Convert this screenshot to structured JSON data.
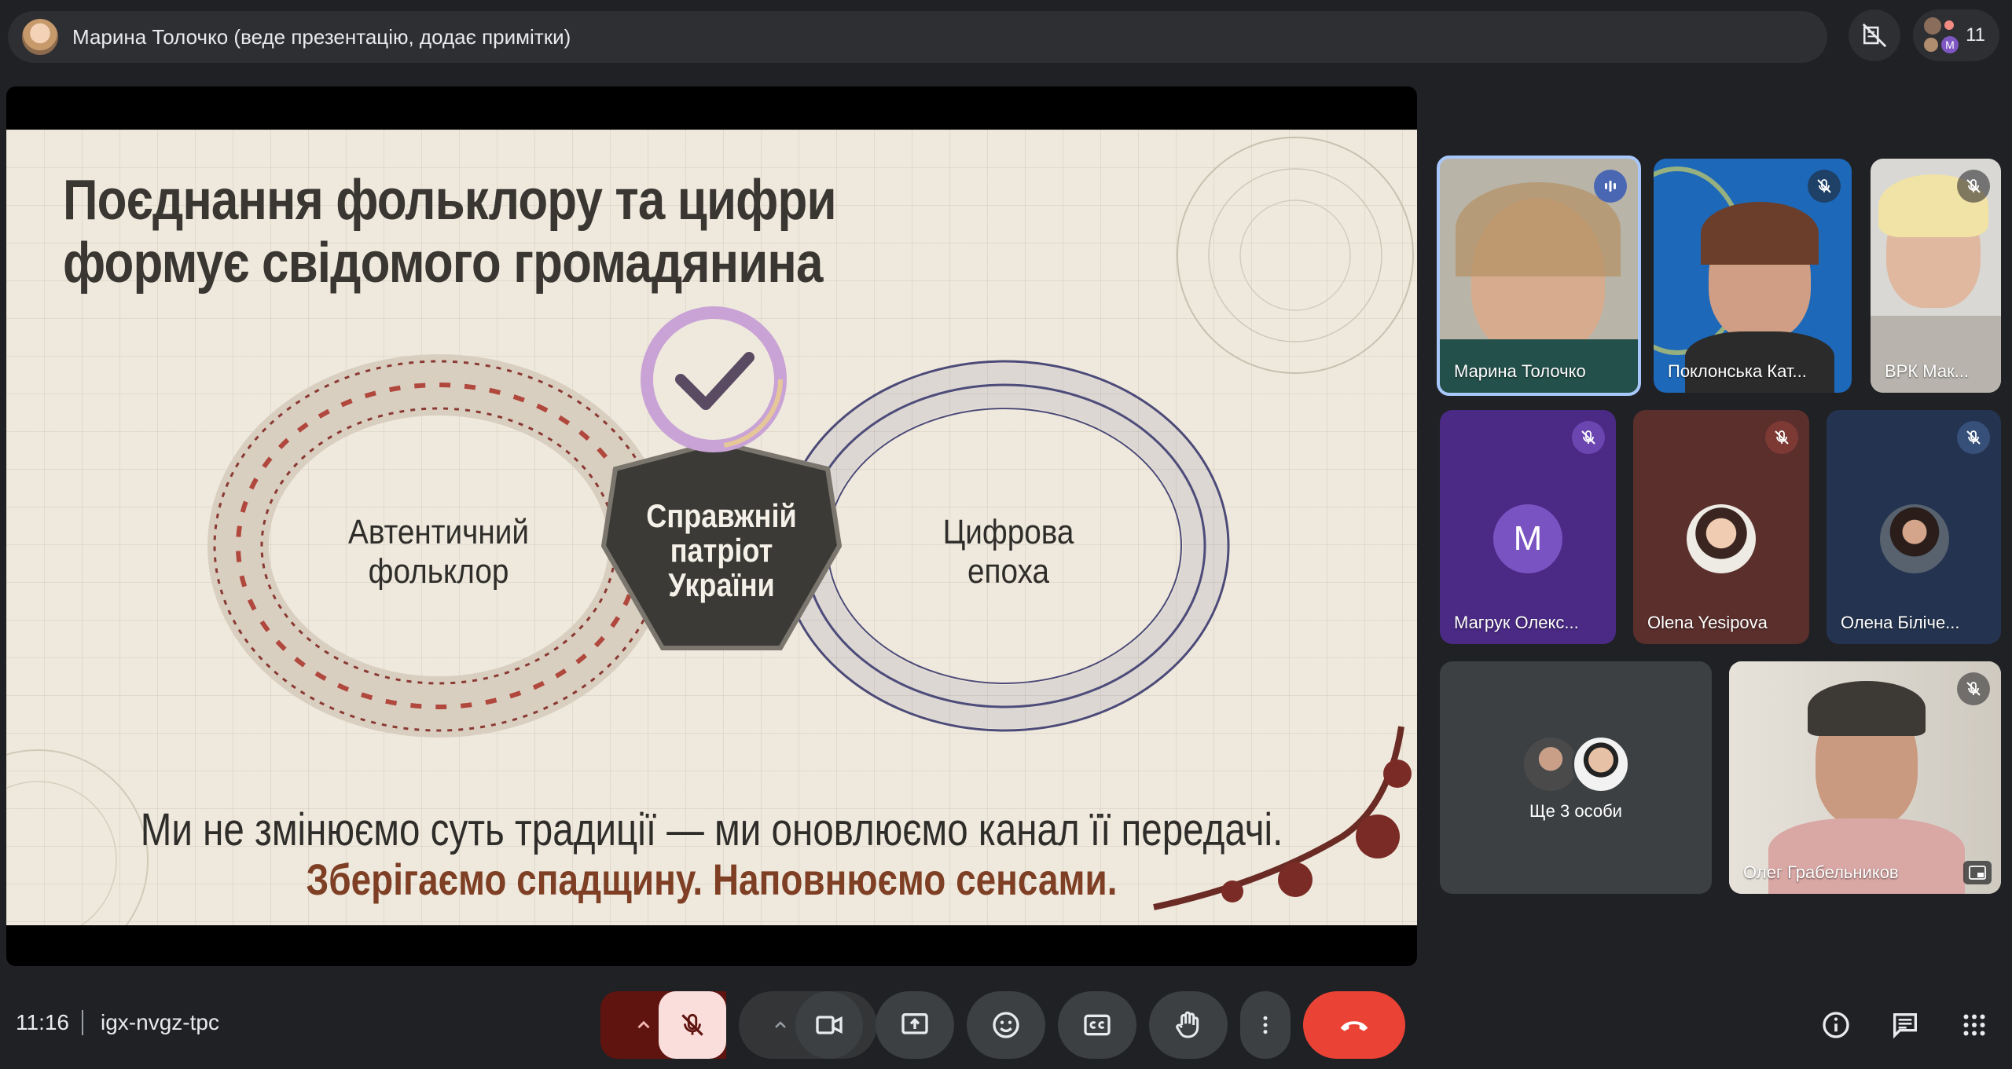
{
  "header": {
    "presenter_title": "Марина Толочко (веде презентацію, додає примітки)",
    "participant_count": "11"
  },
  "slide": {
    "title_line1": "Поєднання фольклору та цифри",
    "title_line2": "формує свідомого громадянина",
    "left_label_line1": "Автентичний",
    "left_label_line2": "фольклор",
    "center_line1": "Справжній",
    "center_line2": "патріот",
    "center_line3": "України",
    "right_label_line1": "Цифрова",
    "right_label_line2": "епоха",
    "subtitle": "Ми не змінюємо суть традиції — ми оновлюємо канал її передачі.",
    "subtitle_accent": "Зберігаємо спадщину. Наповнюємо сенсами."
  },
  "participants": [
    {
      "name": "Марина Толочко",
      "state": "speaking"
    },
    {
      "name": "Поклонська Кат...",
      "state": "muted"
    },
    {
      "name": "ВРК Мак...",
      "state": "muted"
    },
    {
      "name": "Магрук Олекс...",
      "state": "muted",
      "initial": "M"
    },
    {
      "name": "Olena Yesipova",
      "state": "muted"
    },
    {
      "name": "Олена Біліче...",
      "state": "muted"
    },
    {
      "name": "Олег Грабельников",
      "state": "muted"
    }
  ],
  "others_tile": {
    "label": "Ще 3 особи"
  },
  "footer": {
    "time": "11:16",
    "meeting_code": "igx-nvgz-tpc"
  },
  "colors": {
    "background": "#202124",
    "end_call": "#ea4335",
    "mic_off": "#f9dedc",
    "speaking_border": "#a8c7fa"
  }
}
